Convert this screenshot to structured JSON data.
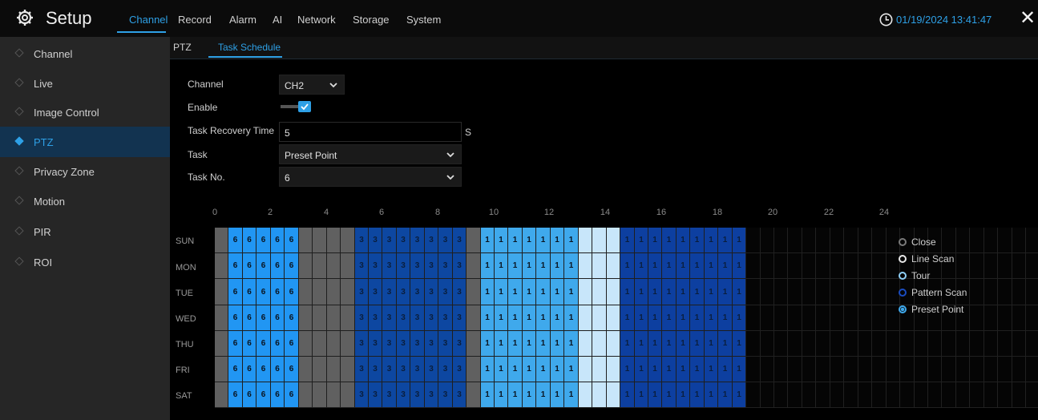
{
  "app": {
    "title": "Setup",
    "datetime": "01/19/2024 13:41:47"
  },
  "nav": {
    "items": [
      "Channel",
      "Record",
      "Alarm",
      "AI",
      "Network",
      "Storage",
      "System"
    ],
    "active": "Channel"
  },
  "sidebar": {
    "items": [
      "Channel",
      "Live",
      "Image Control",
      "PTZ",
      "Privacy Zone",
      "Motion",
      "PIR",
      "ROI"
    ],
    "active": "PTZ"
  },
  "subtabs": {
    "items": [
      "PTZ",
      "Task Schedule"
    ],
    "active": "Task Schedule"
  },
  "form": {
    "channel_label": "Channel",
    "channel_value": "CH2",
    "enable_label": "Enable",
    "enable_checked": true,
    "recovery_label": "Task Recovery Time",
    "recovery_value": "5",
    "recovery_unit": "S",
    "task_label": "Task",
    "task_value": "Preset Point",
    "taskno_label": "Task No.",
    "taskno_value": "6"
  },
  "schedule": {
    "hours": [
      "0",
      "2",
      "4",
      "6",
      "8",
      "10",
      "12",
      "14",
      "16",
      "18",
      "20",
      "22",
      "24"
    ],
    "days": [
      "SUN",
      "MON",
      "TUE",
      "WED",
      "THU",
      "FRI",
      "SAT"
    ],
    "slot_pattern": [
      "C",
      "6",
      "6",
      "6",
      "6",
      "6",
      "C",
      "C",
      "C",
      "C",
      "3",
      "3",
      "3",
      "3",
      "3",
      "3",
      "3",
      "3",
      "C",
      "1",
      "1",
      "1",
      "1",
      "1",
      "1",
      "1",
      "L",
      "L",
      "L",
      "D",
      "D",
      "D",
      "D",
      "D",
      "D",
      "D",
      "D",
      "D",
      "0",
      "0",
      "0",
      "0",
      "0",
      "0",
      "0",
      "0",
      "0",
      "0",
      "0",
      "0",
      "0",
      "0",
      "0",
      "0",
      "0",
      "0",
      "0",
      "0",
      "0",
      "0",
      "0",
      "0"
    ],
    "slot_text": {
      "6": "6",
      "3": "3",
      "1": "1",
      "D": "1"
    }
  },
  "legend": {
    "items": [
      {
        "label": "Close",
        "color": "#7a7a7a"
      },
      {
        "label": "Line Scan",
        "color": "#e8e8e8"
      },
      {
        "label": "Tour",
        "color": "#8fd0f8"
      },
      {
        "label": "Pattern Scan",
        "color": "#1a4cc0"
      },
      {
        "label": "Preset Point",
        "color": "#3fa9ec"
      }
    ],
    "selected": "Preset Point"
  },
  "colors": {
    "accent": "#2ea0e6",
    "sidebar_bg": "#262626",
    "sidebar_active": "#123350"
  }
}
